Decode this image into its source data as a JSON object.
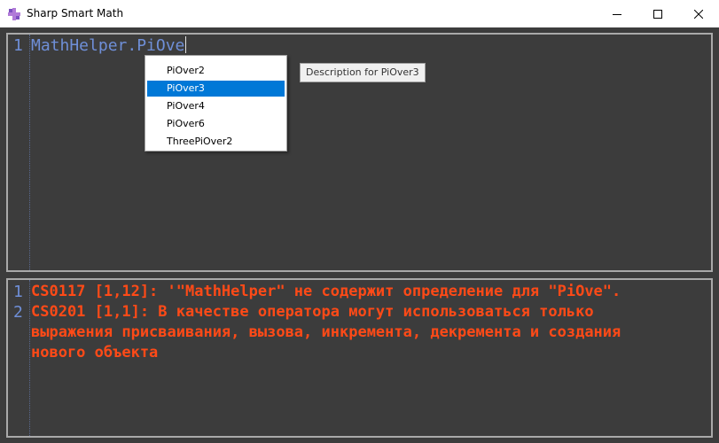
{
  "window": {
    "title": "Sharp Smart Math",
    "icon": "app-logo-icon",
    "controls": [
      "minimize-icon",
      "maximize-icon",
      "close-icon"
    ]
  },
  "editor": {
    "lines": [
      {
        "number": "1",
        "text": "MathHelper.PiOve"
      }
    ],
    "text_color": "#6f8fd8"
  },
  "autocomplete": {
    "items": [
      "PiOver2",
      "PiOver3",
      "PiOver4",
      "PiOver6",
      "ThreePiOver2"
    ],
    "selected": "PiOver3",
    "selected_color": "#0078d7"
  },
  "tooltip": {
    "text": "Description for PiOver3"
  },
  "errors": {
    "color": "#ff4a17",
    "lines": [
      {
        "number": "1",
        "text": "CS0117 [1,12]: '\"MathHelper\" не содержит определение для \"PiOve\"."
      },
      {
        "number": "2",
        "text": "CS0201 [1,1]: В качестве оператора могут использоваться только"
      },
      {
        "number": "",
        "text": "выражения присваивания, вызова, инкремента, декремента и создания"
      },
      {
        "number": "",
        "text": "нового объекта"
      }
    ]
  }
}
